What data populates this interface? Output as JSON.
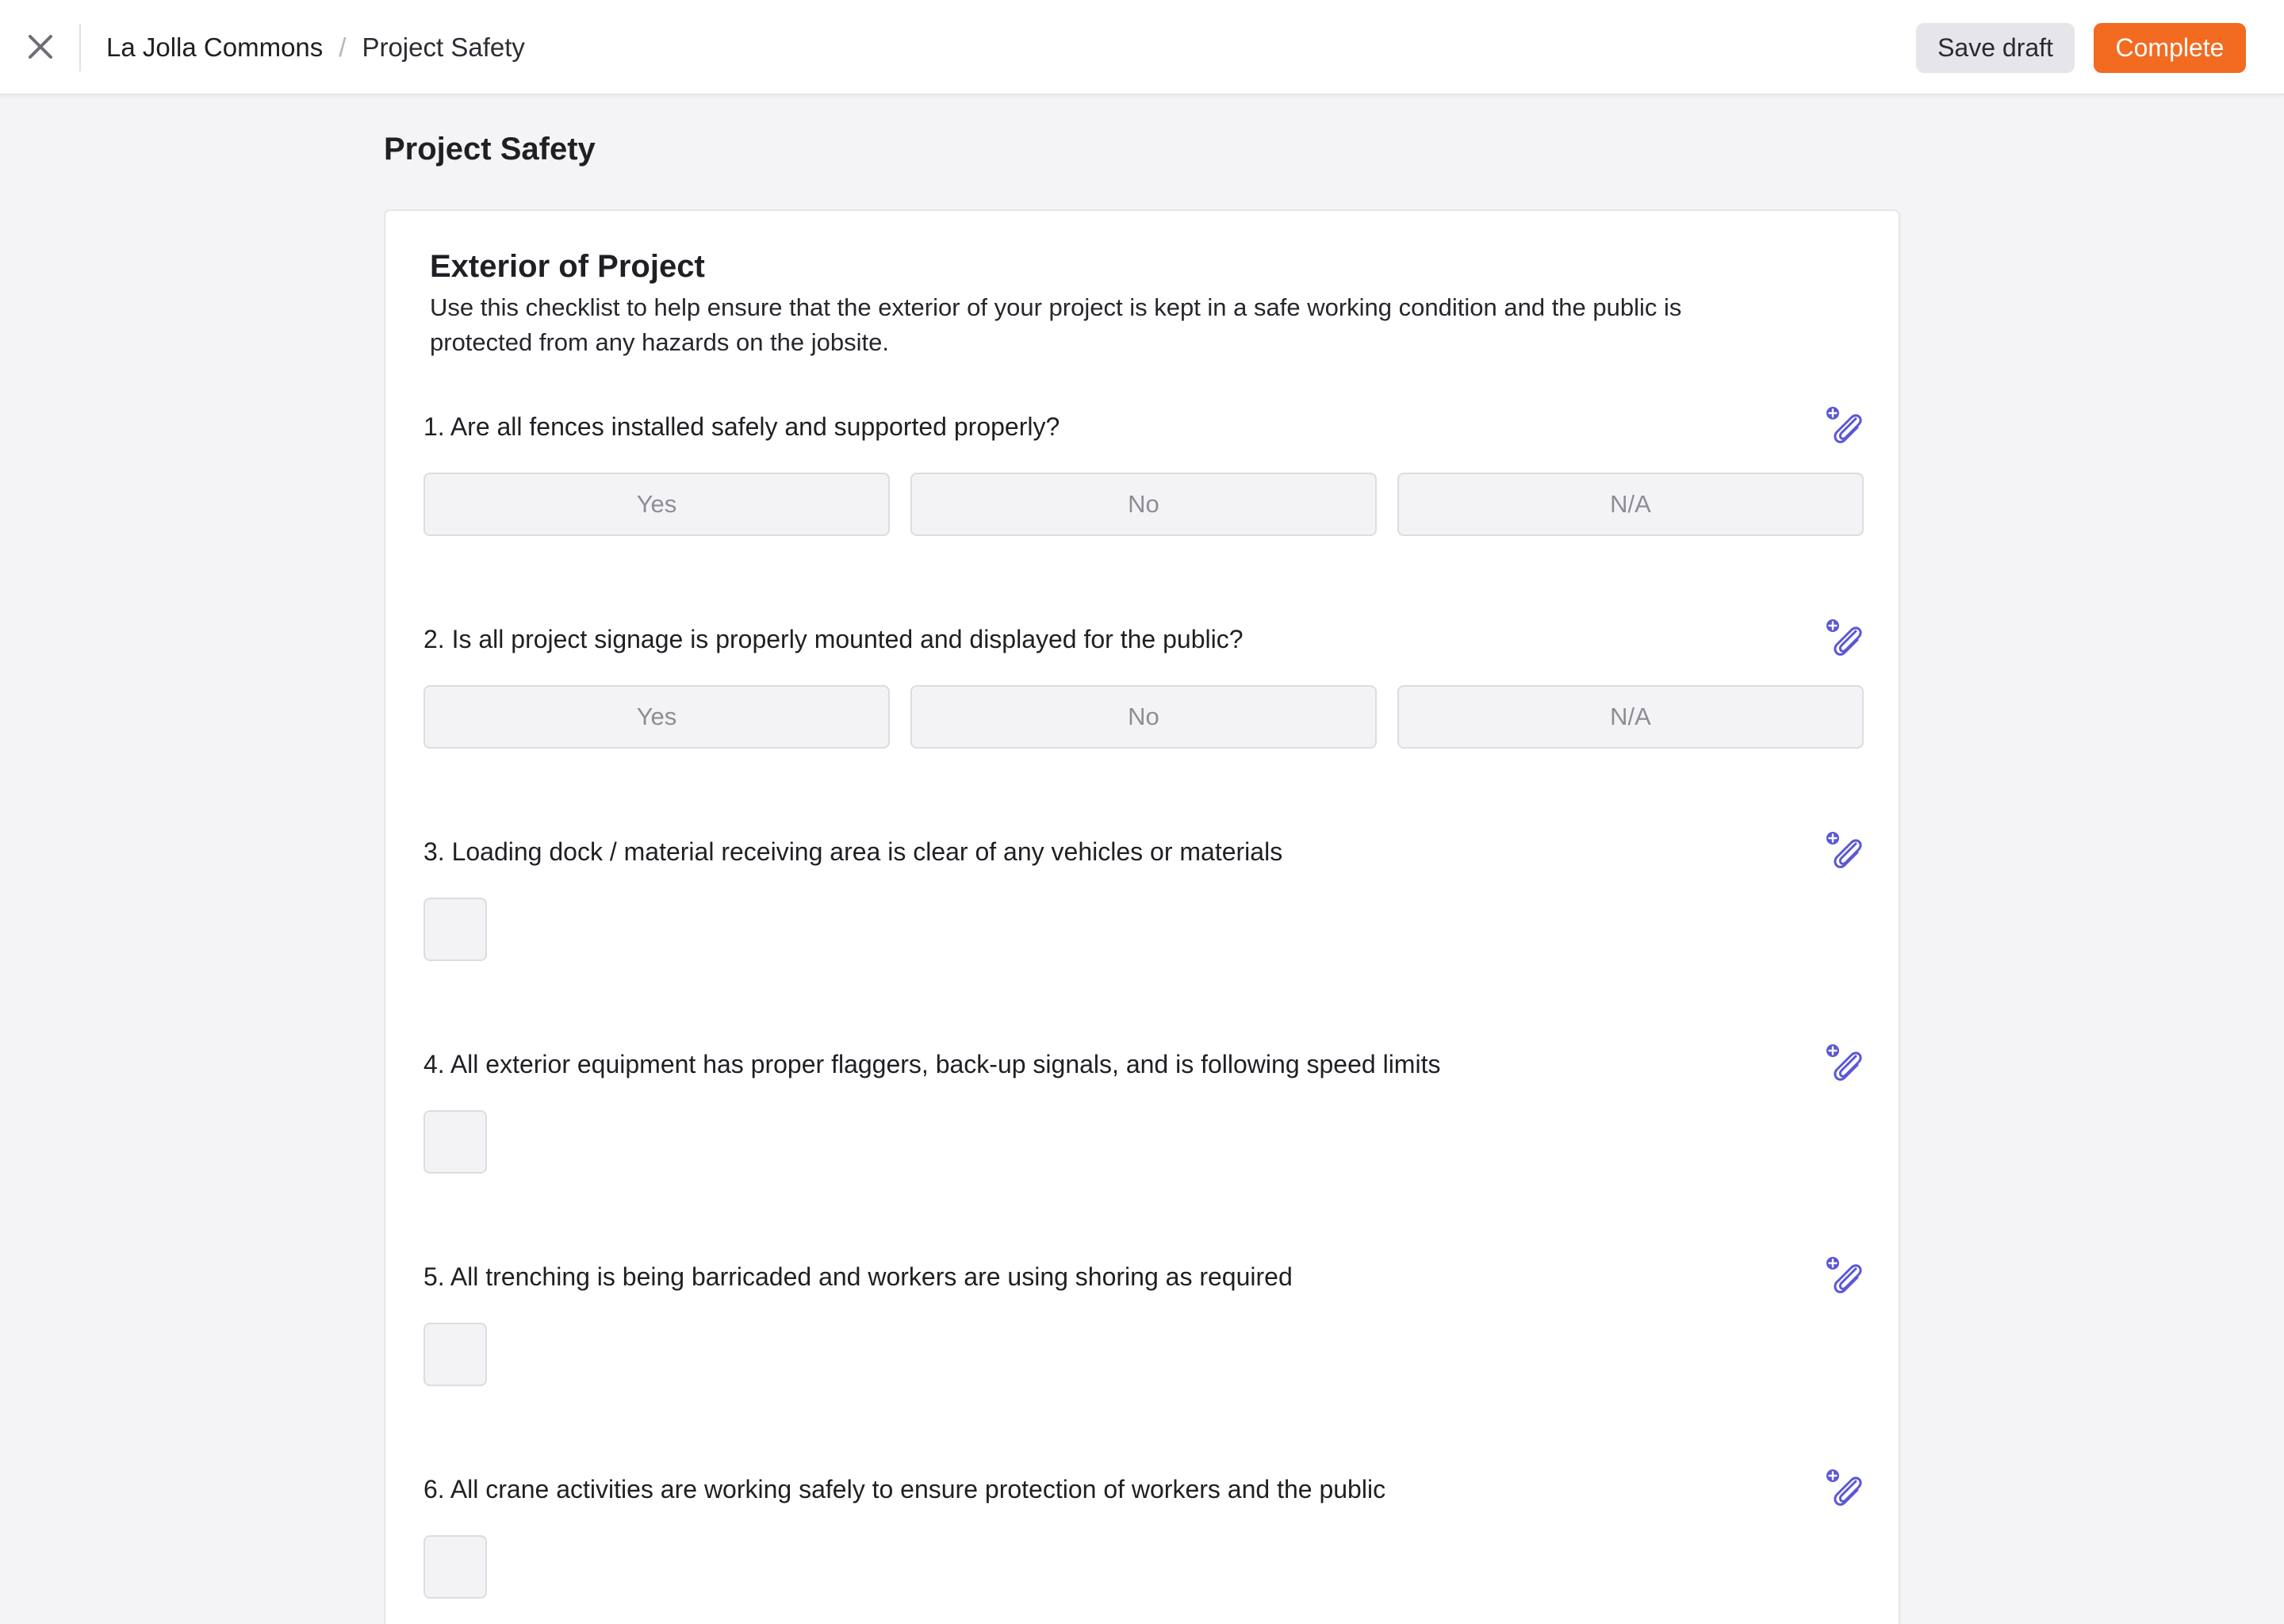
{
  "header": {
    "breadcrumb_project": "La Jolla Commons",
    "breadcrumb_separator": "/",
    "breadcrumb_current": "Project Safety",
    "save_draft_label": "Save draft",
    "complete_label": "Complete",
    "close_icon": "close-icon"
  },
  "page": {
    "title": "Project Safety"
  },
  "section": {
    "title": "Exterior of Project",
    "description": "Use this checklist to help ensure that the exterior of your project is kept in a safe working condition and the public is protected from any hazards on the jobsite."
  },
  "questions": [
    {
      "text": "1. Are all fences installed safely and supported properly?",
      "type": "choice",
      "options": [
        "Yes",
        "No",
        "N/A"
      ]
    },
    {
      "text": "2. Is all project signage is properly mounted and displayed for the public?",
      "type": "choice",
      "options": [
        "Yes",
        "No",
        "N/A"
      ]
    },
    {
      "text": "3. Loading dock / material receiving area is clear of any vehicles or materials",
      "type": "checkbox"
    },
    {
      "text": "4. All exterior equipment has proper flaggers, back-up signals, and is following speed limits",
      "type": "checkbox"
    },
    {
      "text": "5. All trenching is being barricaded and workers are using shoring as required",
      "type": "checkbox"
    },
    {
      "text": "6. All crane activities are working safely to ensure protection of workers and the public",
      "type": "checkbox"
    }
  ],
  "colors": {
    "accent": "#f26b21",
    "attach_icon": "#5b57d6",
    "background": "#f4f4f6"
  },
  "icons": {
    "attach": "attach-add-icon"
  }
}
